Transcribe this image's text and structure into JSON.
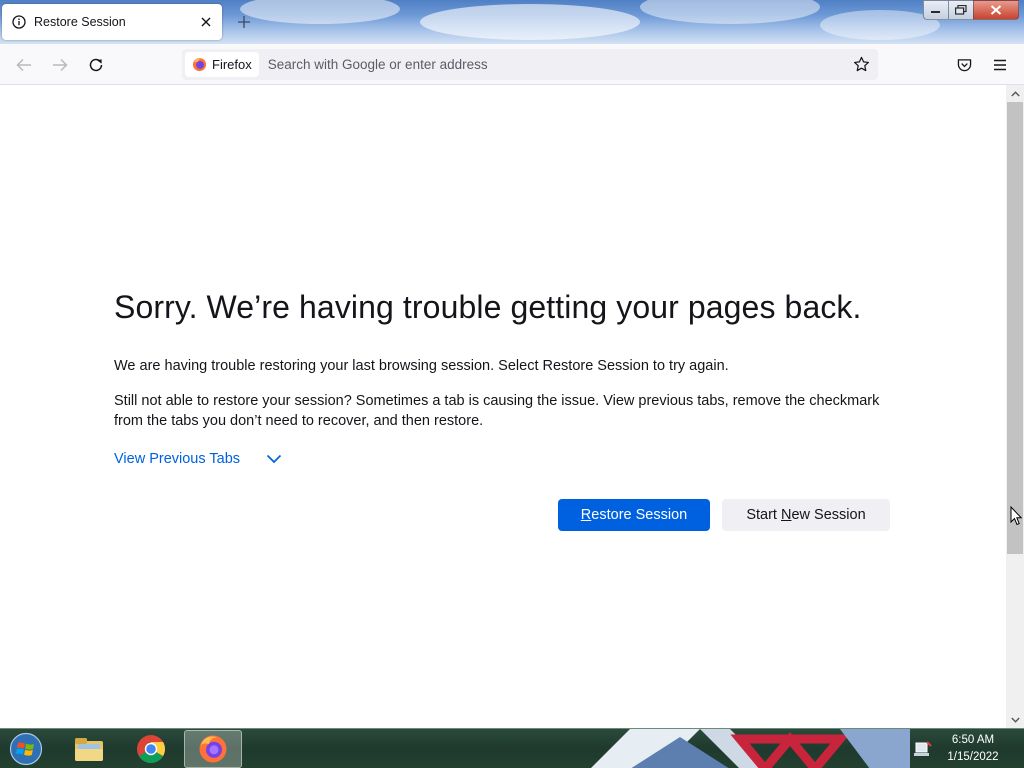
{
  "browser": {
    "tab": {
      "title": "Restore Session"
    },
    "identity_label": "Firefox",
    "search_placeholder": "Search with Google or enter address"
  },
  "page": {
    "heading": "Sorry. We’re having trouble getting your pages back.",
    "paragraph1": "We are having trouble restoring your last browsing session. Select Restore Session to try again.",
    "paragraph2": "Still not able to restore your session? Sometimes a tab is causing the issue. View previous tabs, remove the checkmark from the tabs you don’t need to recover, and then restore.",
    "view_previous_tabs": "View Previous Tabs",
    "restore_button": {
      "prefix": "",
      "accesskey": "R",
      "suffix": "estore Session"
    },
    "new_session_button": {
      "prefix": "Start ",
      "accesskey": "N",
      "suffix": "ew Session"
    }
  },
  "taskbar": {
    "clock_time": "6:50 AM",
    "clock_date": "1/15/2022"
  },
  "colors": {
    "accent_blue": "#0061e0",
    "text_primary": "#15141a",
    "secondary_button": "#f0f0f4"
  }
}
